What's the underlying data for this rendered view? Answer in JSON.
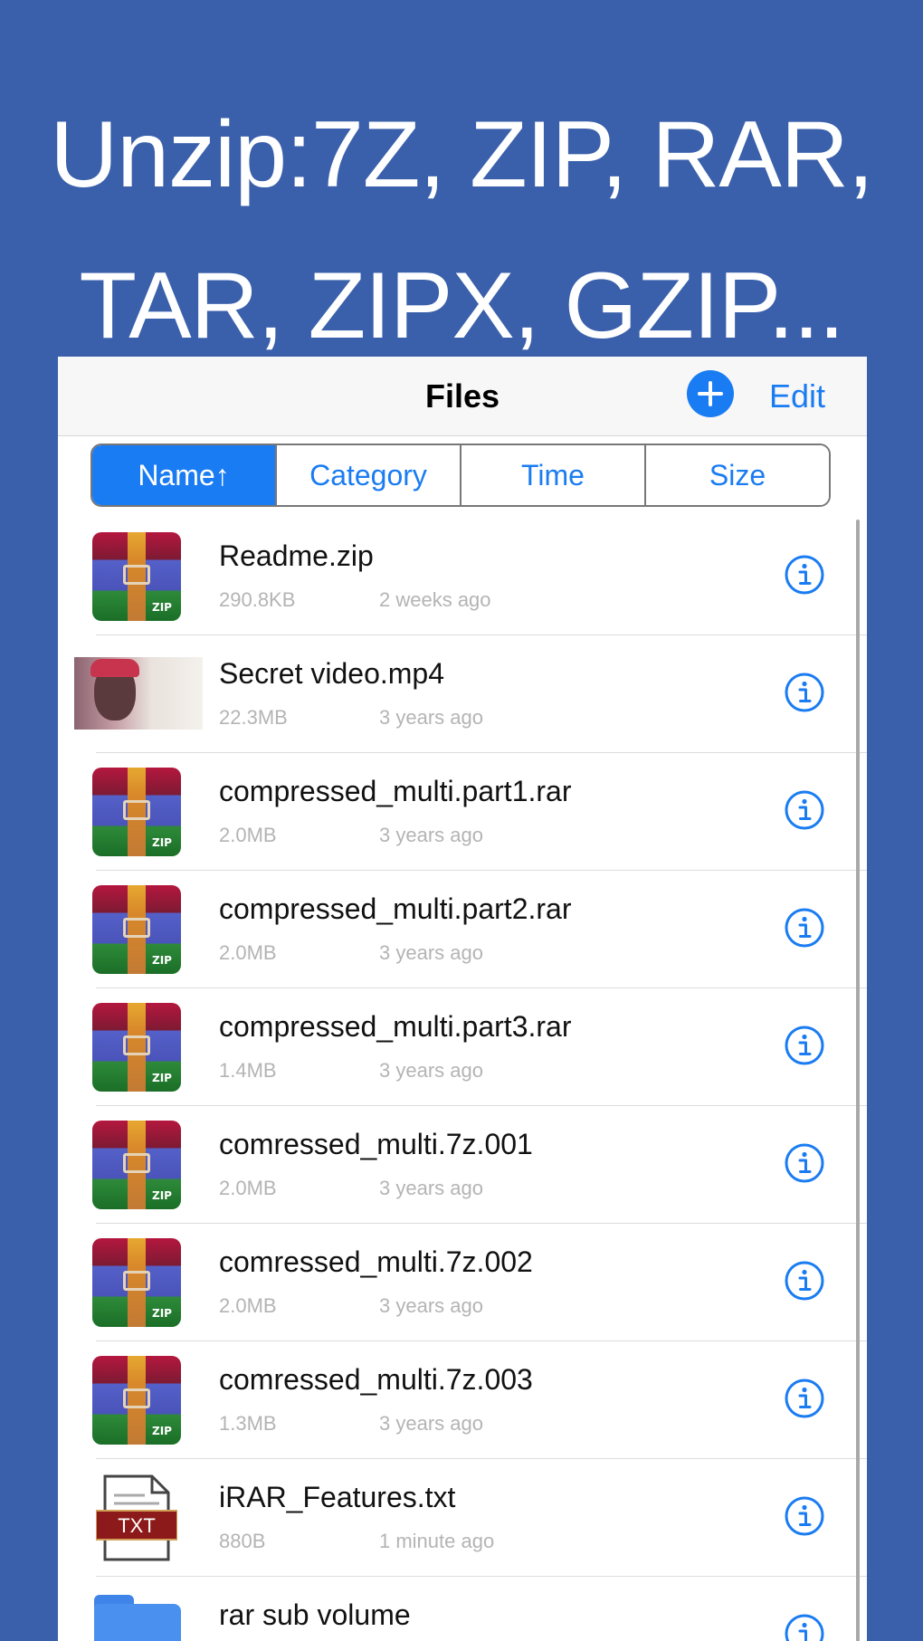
{
  "headline": {
    "line1": "Unzip:7Z, ZIP, RAR,",
    "line2": "TAR, ZIPX, GZIP..."
  },
  "navbar": {
    "title": "Files",
    "add_icon": "plus-circle-icon",
    "edit_label": "Edit"
  },
  "sort": {
    "segments": [
      "Name↑",
      "Category",
      "Time",
      "Size"
    ],
    "active": "Name↑"
  },
  "files": [
    {
      "name": "Readme.zip",
      "size": "290.8KB",
      "time": "2 weeks ago",
      "icon": "zip-archive-icon"
    },
    {
      "name": "Secret video.mp4",
      "size": "22.3MB",
      "time": "3 years ago",
      "icon": "video-thumbnail"
    },
    {
      "name": "compressed_multi.part1.rar",
      "size": "2.0MB",
      "time": "3 years ago",
      "icon": "zip-archive-icon"
    },
    {
      "name": "compressed_multi.part2.rar",
      "size": "2.0MB",
      "time": "3 years ago",
      "icon": "zip-archive-icon"
    },
    {
      "name": "compressed_multi.part3.rar",
      "size": "1.4MB",
      "time": "3 years ago",
      "icon": "zip-archive-icon"
    },
    {
      "name": "comressed_multi.7z.001",
      "size": "2.0MB",
      "time": "3 years ago",
      "icon": "zip-archive-icon"
    },
    {
      "name": "comressed_multi.7z.002",
      "size": "2.0MB",
      "time": "3 years ago",
      "icon": "zip-archive-icon"
    },
    {
      "name": "comressed_multi.7z.003",
      "size": "1.3MB",
      "time": "3 years ago",
      "icon": "zip-archive-icon"
    },
    {
      "name": "iRAR_Features.txt",
      "size": "880B",
      "time": "1 minute ago",
      "icon": "txt-file-icon"
    },
    {
      "name": "rar sub volume",
      "size": "",
      "time": "",
      "icon": "folder-icon"
    }
  ],
  "icon_labels": {
    "zip": "ZIP",
    "txt": "TXT"
  },
  "colors": {
    "background": "#3a60ab",
    "accent": "#1a7cf2",
    "secondary_text": "#b4b4b4"
  }
}
